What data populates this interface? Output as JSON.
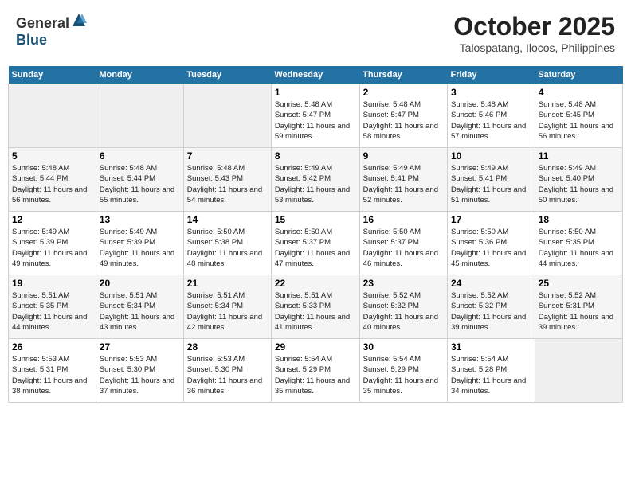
{
  "header": {
    "logo_general": "General",
    "logo_blue": "Blue",
    "month_year": "October 2025",
    "location": "Talospatang, Ilocos, Philippines"
  },
  "weekdays": [
    "Sunday",
    "Monday",
    "Tuesday",
    "Wednesday",
    "Thursday",
    "Friday",
    "Saturday"
  ],
  "weeks": [
    [
      {
        "day": "",
        "empty": true
      },
      {
        "day": "",
        "empty": true
      },
      {
        "day": "",
        "empty": true
      },
      {
        "day": "1",
        "sunrise": "5:48 AM",
        "sunset": "5:47 PM",
        "daylight": "11 hours and 59 minutes."
      },
      {
        "day": "2",
        "sunrise": "5:48 AM",
        "sunset": "5:47 PM",
        "daylight": "11 hours and 58 minutes."
      },
      {
        "day": "3",
        "sunrise": "5:48 AM",
        "sunset": "5:46 PM",
        "daylight": "11 hours and 57 minutes."
      },
      {
        "day": "4",
        "sunrise": "5:48 AM",
        "sunset": "5:45 PM",
        "daylight": "11 hours and 56 minutes."
      }
    ],
    [
      {
        "day": "5",
        "sunrise": "5:48 AM",
        "sunset": "5:44 PM",
        "daylight": "11 hours and 56 minutes."
      },
      {
        "day": "6",
        "sunrise": "5:48 AM",
        "sunset": "5:44 PM",
        "daylight": "11 hours and 55 minutes."
      },
      {
        "day": "7",
        "sunrise": "5:48 AM",
        "sunset": "5:43 PM",
        "daylight": "11 hours and 54 minutes."
      },
      {
        "day": "8",
        "sunrise": "5:49 AM",
        "sunset": "5:42 PM",
        "daylight": "11 hours and 53 minutes."
      },
      {
        "day": "9",
        "sunrise": "5:49 AM",
        "sunset": "5:41 PM",
        "daylight": "11 hours and 52 minutes."
      },
      {
        "day": "10",
        "sunrise": "5:49 AM",
        "sunset": "5:41 PM",
        "daylight": "11 hours and 51 minutes."
      },
      {
        "day": "11",
        "sunrise": "5:49 AM",
        "sunset": "5:40 PM",
        "daylight": "11 hours and 50 minutes."
      }
    ],
    [
      {
        "day": "12",
        "sunrise": "5:49 AM",
        "sunset": "5:39 PM",
        "daylight": "11 hours and 49 minutes."
      },
      {
        "day": "13",
        "sunrise": "5:49 AM",
        "sunset": "5:39 PM",
        "daylight": "11 hours and 49 minutes."
      },
      {
        "day": "14",
        "sunrise": "5:50 AM",
        "sunset": "5:38 PM",
        "daylight": "11 hours and 48 minutes."
      },
      {
        "day": "15",
        "sunrise": "5:50 AM",
        "sunset": "5:37 PM",
        "daylight": "11 hours and 47 minutes."
      },
      {
        "day": "16",
        "sunrise": "5:50 AM",
        "sunset": "5:37 PM",
        "daylight": "11 hours and 46 minutes."
      },
      {
        "day": "17",
        "sunrise": "5:50 AM",
        "sunset": "5:36 PM",
        "daylight": "11 hours and 45 minutes."
      },
      {
        "day": "18",
        "sunrise": "5:50 AM",
        "sunset": "5:35 PM",
        "daylight": "11 hours and 44 minutes."
      }
    ],
    [
      {
        "day": "19",
        "sunrise": "5:51 AM",
        "sunset": "5:35 PM",
        "daylight": "11 hours and 44 minutes."
      },
      {
        "day": "20",
        "sunrise": "5:51 AM",
        "sunset": "5:34 PM",
        "daylight": "11 hours and 43 minutes."
      },
      {
        "day": "21",
        "sunrise": "5:51 AM",
        "sunset": "5:34 PM",
        "daylight": "11 hours and 42 minutes."
      },
      {
        "day": "22",
        "sunrise": "5:51 AM",
        "sunset": "5:33 PM",
        "daylight": "11 hours and 41 minutes."
      },
      {
        "day": "23",
        "sunrise": "5:52 AM",
        "sunset": "5:32 PM",
        "daylight": "11 hours and 40 minutes."
      },
      {
        "day": "24",
        "sunrise": "5:52 AM",
        "sunset": "5:32 PM",
        "daylight": "11 hours and 39 minutes."
      },
      {
        "day": "25",
        "sunrise": "5:52 AM",
        "sunset": "5:31 PM",
        "daylight": "11 hours and 39 minutes."
      }
    ],
    [
      {
        "day": "26",
        "sunrise": "5:53 AM",
        "sunset": "5:31 PM",
        "daylight": "11 hours and 38 minutes."
      },
      {
        "day": "27",
        "sunrise": "5:53 AM",
        "sunset": "5:30 PM",
        "daylight": "11 hours and 37 minutes."
      },
      {
        "day": "28",
        "sunrise": "5:53 AM",
        "sunset": "5:30 PM",
        "daylight": "11 hours and 36 minutes."
      },
      {
        "day": "29",
        "sunrise": "5:54 AM",
        "sunset": "5:29 PM",
        "daylight": "11 hours and 35 minutes."
      },
      {
        "day": "30",
        "sunrise": "5:54 AM",
        "sunset": "5:29 PM",
        "daylight": "11 hours and 35 minutes."
      },
      {
        "day": "31",
        "sunrise": "5:54 AM",
        "sunset": "5:28 PM",
        "daylight": "11 hours and 34 minutes."
      },
      {
        "day": "",
        "empty": true
      }
    ]
  ],
  "labels": {
    "sunrise": "Sunrise:",
    "sunset": "Sunset:",
    "daylight": "Daylight:"
  }
}
